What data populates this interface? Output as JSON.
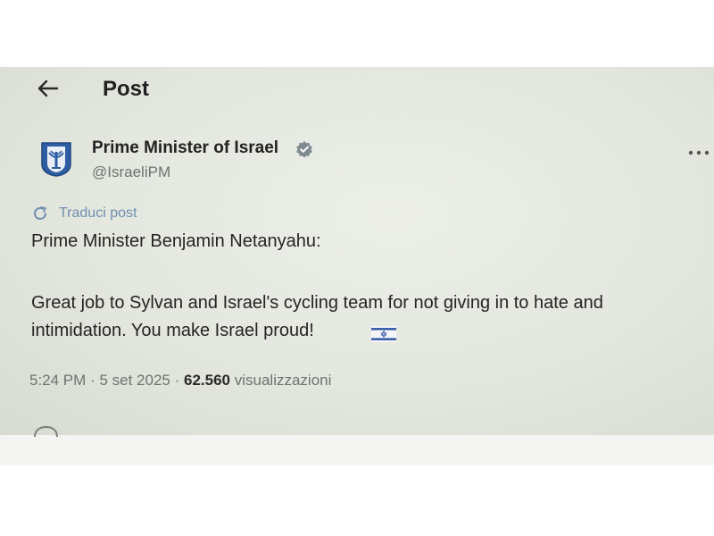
{
  "header": {
    "title": "Post"
  },
  "author": {
    "name": "Prime Minister of Israel",
    "handle": "@IsraeliPM",
    "verified": true,
    "avatar_icon": "israel-emblem-icon"
  },
  "translate_label": "Traduci post",
  "tweet": {
    "line1": "Prime Minister Benjamin Netanyahu:",
    "line2": "Great job to Sylvan and Israel's cycling team for not giving in to hate and",
    "line3": "intimidation. You make Israel proud!",
    "flag_icon": "israel-flag-icon"
  },
  "meta": {
    "time": "5:24 PM",
    "date": "5 set 2025",
    "separator": "·",
    "views_count": "62.560",
    "views_label": "visualizzazioni"
  },
  "colors": {
    "background": "#e3e7de",
    "link": "#6f8fb0",
    "muted": "#6e7370",
    "flag_blue": "#3a5fa8"
  }
}
